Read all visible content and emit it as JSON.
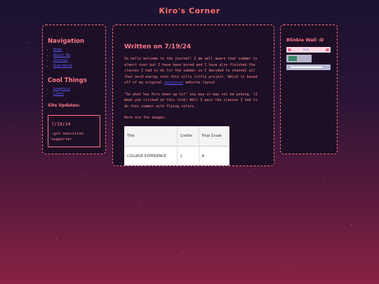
{
  "site": {
    "title": "Kiro's Corner"
  },
  "nav": {
    "title": "Navigation",
    "items": [
      {
        "label": "Home"
      },
      {
        "label": "About Me"
      },
      {
        "label": "Journal"
      },
      {
        "label": "Guestbook"
      }
    ]
  },
  "cool": {
    "title": "Cool Things",
    "items": [
      {
        "label": "Graphics"
      },
      {
        "label": "Links"
      }
    ]
  },
  "updates": {
    "title": "Site Updates:",
    "entries": [
      {
        "date": "7/19/24",
        "text": "-got neocities supporter"
      }
    ]
  },
  "post": {
    "title": "Written on 7/19/24",
    "p1": "So hello welcome to the journal! I am well aware that summer is almost over but I have been bored and I have also finished the classes I had to do for the summer so I decided to channel all that nerd energy into this silly little project. Which is based off of my original",
    "p1_link": "neocities",
    "p1_tail": "website layout.",
    "p2": "\"So what has Kiro been up to?\" you may or may not be asking. (I mean you clicked on this link) Well I pass the classes I had to do this summer with flying colors.",
    "p3": "Here are the images:",
    "table": {
      "headers": [
        "Title",
        "Credits",
        "Final Grade"
      ],
      "rows": [
        [
          "COLLEGE EXPERIENCE",
          "1",
          "A"
        ]
      ]
    }
  },
  "blinkies": {
    "title": "Blinkie Wall :D",
    "items": [
      {
        "name": "hearts-blinkie",
        "text": "love"
      },
      {
        "name": "game-blinkie",
        "text": ""
      },
      {
        "name": "stripe-blinkie",
        "text": ""
      }
    ]
  },
  "colors": {
    "accent": "#ff6f80",
    "link": "#5a5cff",
    "panel": "#1d0f26"
  }
}
